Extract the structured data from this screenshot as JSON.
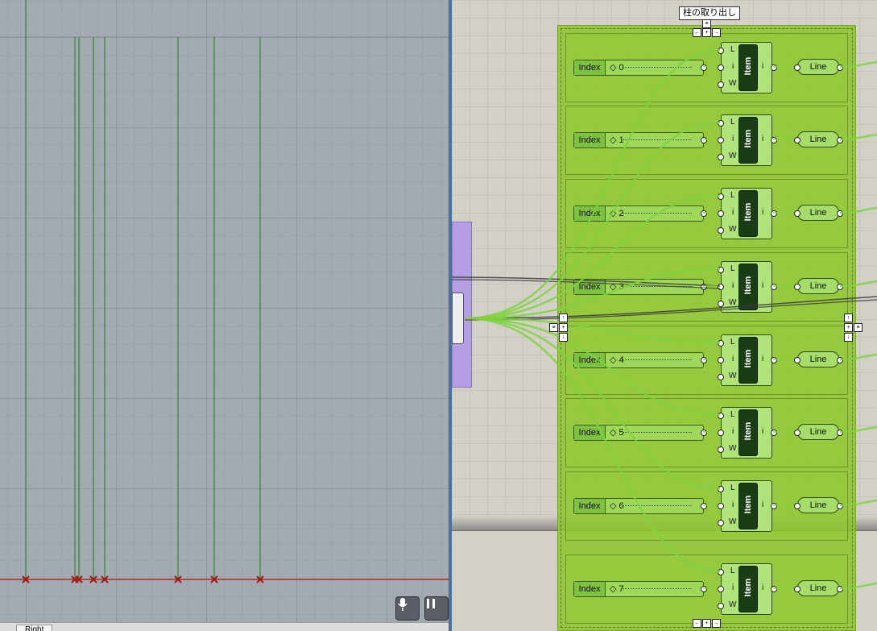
{
  "viewport": {
    "tab_label": "Right",
    "mic_icon": "microphone-icon",
    "pause_icon": "pause-icon",
    "colors": {
      "line": "#2f8a2f",
      "axis": "#b52d2d",
      "marker": "#a21818"
    }
  },
  "canvas": {
    "cluster_title": "柱の取り出し",
    "rows": [
      {
        "index_label": "Index",
        "value": "0",
        "item_label": "Item",
        "pin_l": "L",
        "pin_i": "i",
        "pin_w": "W",
        "out": "i",
        "line_label": "Line"
      },
      {
        "index_label": "Index",
        "value": "1",
        "item_label": "Item",
        "pin_l": "L",
        "pin_i": "i",
        "pin_w": "W",
        "out": "i",
        "line_label": "Line"
      },
      {
        "index_label": "Index",
        "value": "2",
        "item_label": "Item",
        "pin_l": "L",
        "pin_i": "i",
        "pin_w": "W",
        "out": "i",
        "line_label": "Line"
      },
      {
        "index_label": "Index",
        "value": "3",
        "item_label": "Item",
        "pin_l": "L",
        "pin_i": "i",
        "pin_w": "W",
        "out": "i",
        "line_label": "Line"
      },
      {
        "index_label": "Index",
        "value": "4",
        "item_label": "Item",
        "pin_l": "L",
        "pin_i": "i",
        "pin_w": "W",
        "out": "i",
        "line_label": "Line"
      },
      {
        "index_label": "Index",
        "value": "5",
        "item_label": "Item",
        "pin_l": "L",
        "pin_i": "i",
        "pin_w": "W",
        "out": "i",
        "line_label": "Line"
      },
      {
        "index_label": "Index",
        "value": "6",
        "item_label": "Item",
        "pin_l": "L",
        "pin_i": "i",
        "pin_w": "W",
        "out": "i",
        "line_label": "Line"
      },
      {
        "index_label": "Index",
        "value": "7",
        "item_label": "Item",
        "pin_l": "L",
        "pin_i": "i",
        "pin_w": "W",
        "out": "i",
        "line_label": "Line"
      }
    ],
    "colors": {
      "wire": "#7fd23e",
      "group": "#8cc428",
      "dark_wire": "#3a3a3a"
    }
  }
}
